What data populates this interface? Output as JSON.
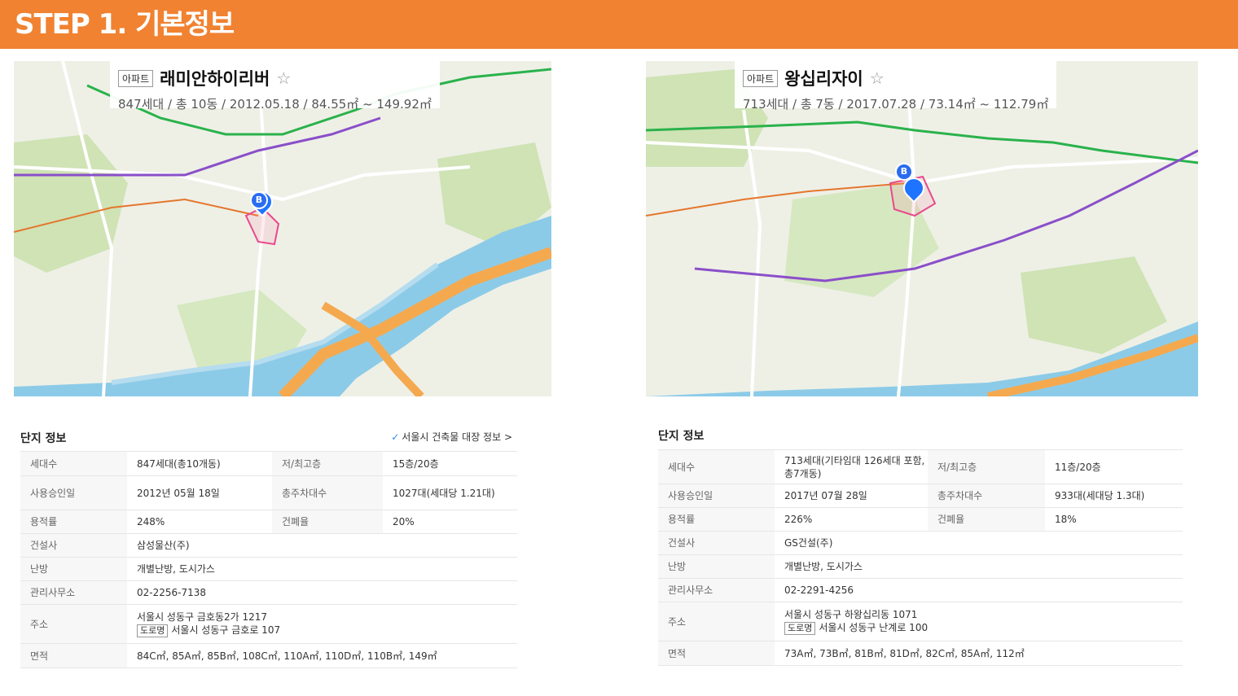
{
  "header": {
    "title": "STEP 1. 기본정보"
  },
  "left": {
    "card": {
      "type": "아파트",
      "name": "래미안하이리버",
      "summary": "847세대 / 총 10동 / 2012.05.18 / 84.55㎡ ~ 149.92㎡"
    },
    "info": {
      "title": "단지 정보",
      "link": "서울시 건축물 대장 정보 >",
      "rows": {
        "households_label": "세대수",
        "households": "847세대(총10개동)",
        "floors_label": "저/최고층",
        "floors": "15층/20층",
        "approval_label": "사용승인일",
        "approval": "2012년 05월 18일",
        "parking_label": "총주차대수",
        "parking": "1027대(세대당 1.21대)",
        "far_label": "용적률",
        "far": "248%",
        "bcr_label": "건폐율",
        "bcr": "20%",
        "builder_label": "건설사",
        "builder": "삼성물산(주)",
        "heating_label": "난방",
        "heating": "개별난방, 도시가스",
        "office_label": "관리사무소",
        "office": "02-2256-7138",
        "address_label": "주소",
        "address": "서울시 성동구 금호동2가 1217",
        "road_tag": "도로명",
        "road_address": "서울시 성동구 금호로 107",
        "area_label": "면적",
        "area": "84C㎡, 85A㎡, 85B㎡, 108C㎡, 110A㎡, 110D㎡, 110B㎡, 149㎡"
      }
    }
  },
  "right": {
    "card": {
      "type": "아파트",
      "name": "왕십리자이",
      "summary": "713세대 / 총 7동 / 2017.07.28 / 73.14㎡ ~ 112.79㎡"
    },
    "info": {
      "title": "단지 정보",
      "rows": {
        "households_label": "세대수",
        "households": "713세대(기타임대 126세대 포함, 총7개동)",
        "floors_label": "저/최고층",
        "floors": "11층/20층",
        "approval_label": "사용승인일",
        "approval": "2017년 07월 28일",
        "parking_label": "총주차대수",
        "parking": "933대(세대당 1.3대)",
        "far_label": "용적률",
        "far": "226%",
        "bcr_label": "건폐율",
        "bcr": "18%",
        "builder_label": "건설사",
        "builder": "GS건설(주)",
        "heating_label": "난방",
        "heating": "개별난방, 도시가스",
        "office_label": "관리사무소",
        "office": "02-2291-4256",
        "address_label": "주소",
        "address": "서울시 성동구 하왕십리동 1071",
        "road_tag": "도로명",
        "road_address": "서울시 성동구 난계로 100",
        "area_label": "면적",
        "area": "73A㎡, 73B㎡, 81B㎡, 81D㎡, 82C㎡, 85A㎡, 112㎡"
      }
    }
  },
  "colors": {
    "header": "#f08231",
    "marker": "#1f74ff",
    "river": "#8ccbe8",
    "road": "#f5a94e",
    "park": "#cfe3b5"
  }
}
